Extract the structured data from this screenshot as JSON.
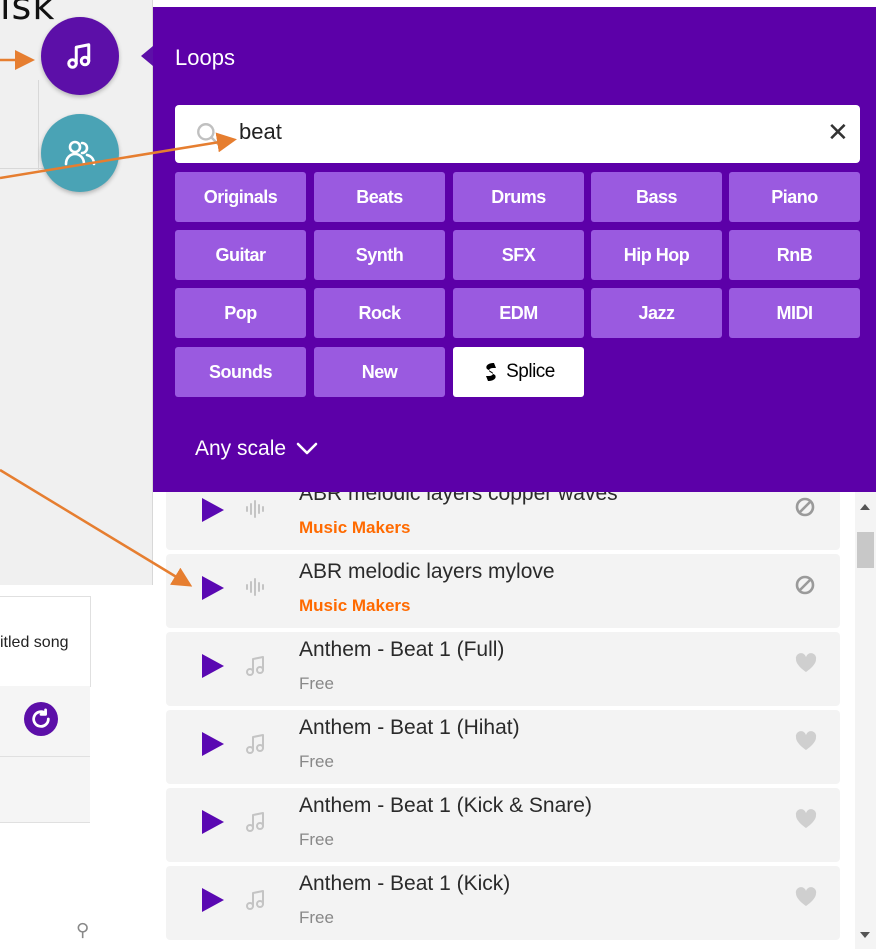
{
  "corner_text": "isk",
  "colors": {
    "panel": "#5c00a8",
    "chip": "#9a5ae0",
    "maker": "#ff6a00",
    "arrow": "#e67e30"
  },
  "icons": {
    "music": "music-note-icon",
    "collab": "people-icon",
    "search": "magnifier-icon",
    "clear": "close-icon",
    "splice": "splice-logo-icon",
    "chevron": "chevron-down-icon"
  },
  "panel": {
    "title": "Loops",
    "search": {
      "value": "beat",
      "clear": "✕"
    },
    "chips": [
      [
        "Originals",
        "Beats",
        "Drums",
        "Bass",
        "Piano"
      ],
      [
        "Guitar",
        "Synth",
        "SFX",
        "Hip Hop",
        "RnB"
      ],
      [
        "Pop",
        "Rock",
        "EDM",
        "Jazz",
        "MIDI"
      ],
      [
        "Sounds",
        "New",
        "Splice"
      ]
    ],
    "scale_label": "Any scale"
  },
  "left": {
    "song_title": "itled song"
  },
  "list": {
    "rows": [
      {
        "name": "ABR melodic layers copper waves",
        "sub": "Music Makers",
        "kind": "waveform",
        "end": "blocked"
      },
      {
        "name": "ABR melodic layers mylove",
        "sub": "Music Makers",
        "kind": "waveform",
        "end": "blocked"
      },
      {
        "name": "Anthem - Beat 1 (Full)",
        "sub": "Free",
        "kind": "note",
        "end": "heart"
      },
      {
        "name": "Anthem - Beat 1 (Hihat)",
        "sub": "Free",
        "kind": "note",
        "end": "heart"
      },
      {
        "name": "Anthem - Beat 1 (Kick & Snare)",
        "sub": "Free",
        "kind": "note",
        "end": "heart"
      },
      {
        "name": "Anthem - Beat 1 (Kick)",
        "sub": "Free",
        "kind": "note",
        "end": "heart"
      }
    ]
  }
}
